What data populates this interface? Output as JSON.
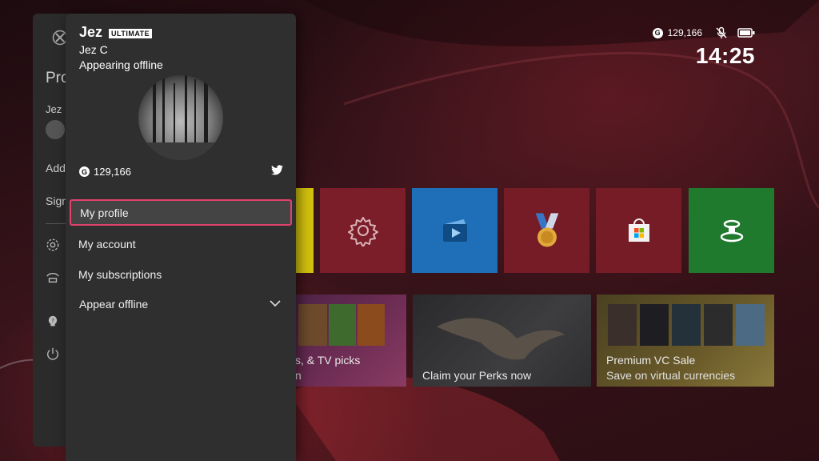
{
  "status": {
    "gamerscore": "129,166",
    "time": "14:25"
  },
  "profile": {
    "gamertag": "Jez",
    "tier": "ULTIMATE",
    "real_name": "Jez C",
    "presence": "Appearing offline",
    "gamerscore": "129,166",
    "gamerscore_badge": "G"
  },
  "menu": [
    {
      "label": "My profile",
      "selected": true
    },
    {
      "label": "My account"
    },
    {
      "label": "My subscriptions"
    },
    {
      "label": "Appear offline"
    }
  ],
  "guide_back": {
    "title": "Pro",
    "user": "Jez",
    "add": "Add",
    "sign": "Sign"
  },
  "cards": [
    {
      "line1": "s, & TV picks",
      "line2": "n"
    },
    {
      "line1": "Claim your Perks now"
    },
    {
      "line1": "Premium VC Sale",
      "line2": "Save on virtual currencies"
    }
  ],
  "tile_colors": [
    "#d4c20e",
    "#7c1e29",
    "#1f6fb8",
    "#761c26",
    "#761c26",
    "#1f7a2e"
  ],
  "accent_color": "#e0426e",
  "icons": [
    "xbox-logo-icon",
    "settings-gear-icon",
    "media-player-icon",
    "achievement-medal-icon",
    "microsoft-store-icon",
    "accessory-icon",
    "twitter-icon",
    "chevron-down-icon",
    "mic-muted-icon",
    "battery-icon",
    "help-icon",
    "power-icon"
  ]
}
